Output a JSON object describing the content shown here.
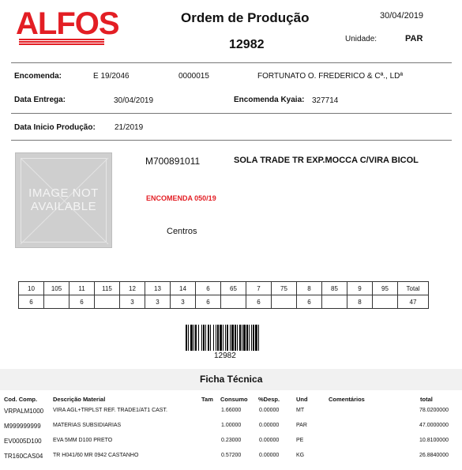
{
  "logo": {
    "text": "ALFOS"
  },
  "header": {
    "title": "Ordem de Produção",
    "order_number": "12982",
    "date": "30/04/2019",
    "unit_label": "Unidade:",
    "unit_value": "PAR"
  },
  "info": {
    "encomenda_label": "Encomenda:",
    "encomenda_ref": "E 19/2046",
    "encomenda_code": "0000015",
    "customer": "FORTUNATO O. FREDERICO & Cª., LDª",
    "data_entrega_label": "Data Entrega:",
    "data_entrega": "30/04/2019",
    "encomenda_kyaia_label": "Encomenda Kyaia:",
    "encomenda_kyaia": "327714",
    "data_inicio_label": "Data Inicio Produção:",
    "data_inicio": "21/2019"
  },
  "product": {
    "image_placeholder_line1": "IMAGE NOT",
    "image_placeholder_line2": "AVAILABLE",
    "code": "M700891011",
    "description": "SOLA TRADE TR EXP.MOCCA C/VIRA BICOL",
    "encomenda_note": "ENCOMENDA 050/19",
    "centros": "Centros"
  },
  "sizes": {
    "headers": [
      "10",
      "105",
      "11",
      "115",
      "12",
      "13",
      "14",
      "6",
      "65",
      "7",
      "75",
      "8",
      "85",
      "9",
      "95",
      "Total"
    ],
    "quantities": [
      "6",
      "",
      "6",
      "",
      "3",
      "3",
      "3",
      "6",
      "",
      "6",
      "",
      "6",
      "",
      "8",
      "",
      "47"
    ]
  },
  "barcode": {
    "number": "12982"
  },
  "ficha": {
    "title": "Ficha Técnica",
    "columns": {
      "code": "Cod. Comp.",
      "description": "Descrição Material",
      "tam": "Tam",
      "consumo": "Consumo",
      "desp": "%Desp.",
      "und": "Und",
      "comentarios": "Comentários",
      "total": "total"
    },
    "rows": [
      {
        "code": "VRPALM1000",
        "description": "VIRA AGL+TRPLST REF. TRADE1/AT1 CAST.",
        "tam": "",
        "consumo": "1.66000",
        "desp": "0.00000",
        "und": "MT",
        "comentarios": "",
        "total": "78.0200000"
      },
      {
        "code": "M999999999",
        "description": "MATERIAS SUBSIDIARIAS",
        "tam": "",
        "consumo": "1.00000",
        "desp": "0.00000",
        "und": "PAR",
        "comentarios": "",
        "total": "47.0000000"
      },
      {
        "code": "EV0005D100",
        "description": "EVA 5MM D100 PRETO",
        "tam": "",
        "consumo": "0.23000",
        "desp": "0.00000",
        "und": "PE",
        "comentarios": "",
        "total": "10.8100000"
      },
      {
        "code": "TR160CAS04",
        "description": "TR H041/60 MR 0942 CASTANHO",
        "tam": "",
        "consumo": "0.57200",
        "desp": "0.00000",
        "und": "KG",
        "comentarios": "",
        "total": "26.8840000"
      }
    ]
  },
  "colors": {
    "brand_red": "#e31e24",
    "band_gray": "#f1f1f1"
  }
}
